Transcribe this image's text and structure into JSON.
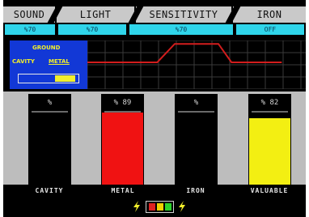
{
  "tabs": [
    {
      "label": "SOUND"
    },
    {
      "label": "LIGHT"
    },
    {
      "label": "SENSITIVITY"
    },
    {
      "label": "IRON"
    }
  ],
  "values": [
    "%70",
    "%70",
    "%70",
    "OFF"
  ],
  "ground_panel": {
    "title": "GROUND",
    "cavity_label": "CAVITY",
    "metal_label": "METAL",
    "ratio_level": 0.36
  },
  "signal_graph": {
    "points": [
      [
        0,
        0.45
      ],
      [
        0.32,
        0.45
      ],
      [
        0.4,
        0.07
      ],
      [
        0.6,
        0.07
      ],
      [
        0.66,
        0.45
      ],
      [
        0.89,
        0.45
      ]
    ],
    "color": "#d21d1d"
  },
  "bars": [
    {
      "header": "%",
      "label": "CAVITY",
      "level": 0,
      "color": "#000000"
    },
    {
      "header": "% 89",
      "label": "METAL",
      "level": 0.89,
      "color": "#f01212"
    },
    {
      "header": "%",
      "label": "IRON",
      "level": 0,
      "color": "#000000"
    },
    {
      "header": "% 82",
      "label": "VALUABLE",
      "level": 0.82,
      "color": "#f3ef12"
    }
  ],
  "battery": {
    "colors": [
      "#e02020",
      "#f0d000",
      "#2ad02a"
    ]
  },
  "colors": {
    "accent_cyan": "#2fd5ea",
    "panel_blue": "#1238d6",
    "text_yellow": "#f2ef2b"
  }
}
